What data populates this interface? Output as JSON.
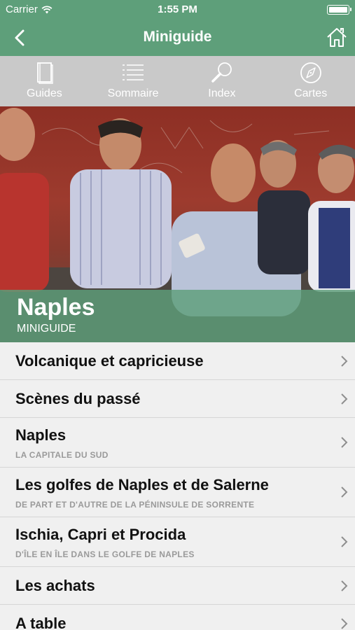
{
  "status": {
    "carrier": "Carrier",
    "time": "1:55 PM"
  },
  "nav": {
    "title": "Miniguide",
    "back_icon": "chevron-left-icon",
    "home_icon": "home-icon"
  },
  "toolbar": {
    "items": [
      {
        "label": "Guides",
        "icon": "book-icon"
      },
      {
        "label": "Sommaire",
        "icon": "list-icon"
      },
      {
        "label": "Index",
        "icon": "magnifier-icon"
      },
      {
        "label": "Cartes",
        "icon": "compass-icon"
      }
    ]
  },
  "hero": {
    "title": "Naples",
    "subtitle": "MINIGUIDE"
  },
  "list": {
    "items": [
      {
        "title": "Volcanique et capricieuse"
      },
      {
        "title": "Scènes du passé"
      },
      {
        "title": "Naples",
        "subtitle": "LA CAPITALE DU SUD"
      },
      {
        "title": "Les golfes de Naples et de Salerne",
        "subtitle": "DE PART ET D'AUTRE DE LA PÉNINSULE DE SORRENTE"
      },
      {
        "title": "Ischia, Capri et Procida",
        "subtitle": "D'ÎLE EN ÎLE DANS LE GOLFE DE NAPLES"
      },
      {
        "title": "Les achats"
      },
      {
        "title": "A table"
      }
    ]
  },
  "colors": {
    "brand": "#5e9f7a",
    "toolbar": "#c9c9c9",
    "list_bg": "#f0f0f0",
    "subtitle": "#9a9a9a"
  }
}
